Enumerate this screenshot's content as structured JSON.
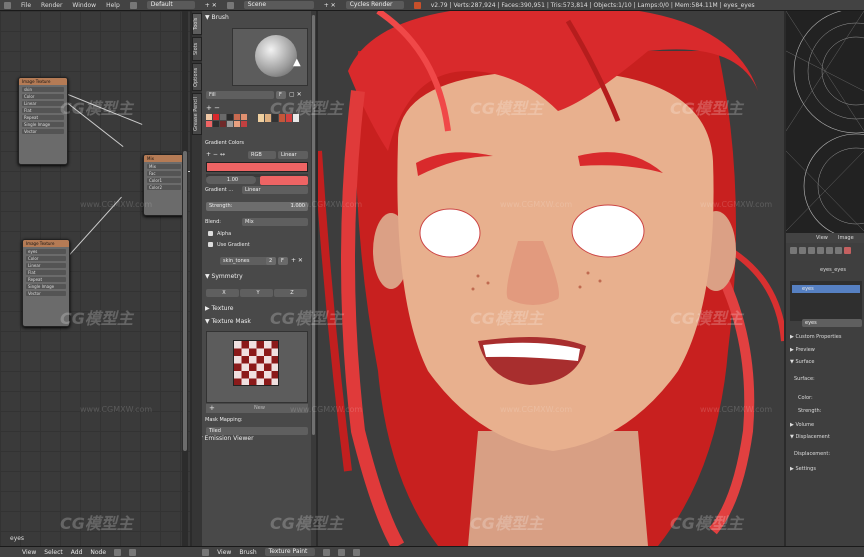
{
  "topbar": {
    "menus": [
      "File",
      "Render",
      "Window",
      "Help"
    ],
    "layout": "Default",
    "scene": "Scene",
    "engine": "Cycles Render",
    "stats": "v2.79 | Verts:287,924 | Faces:390,951 | Tris:573,814 | Objects:1/10 | Lamps:0/0 | Mem:584.11M | eyes_eyes"
  },
  "node_editor": {
    "nodes": [
      {
        "title": "Image Texture",
        "rows": [
          "skin",
          "Color",
          "Linear",
          "Flat",
          "Repeat",
          "Single Image",
          "Vector"
        ]
      },
      {
        "title": "Mix",
        "rows": [
          "Mix",
          "Fac",
          "Color1",
          "Color2"
        ]
      },
      {
        "title": "Image Texture",
        "rows": [
          "eyes",
          "Color",
          "Linear",
          "Flat",
          "Repeat",
          "Single Image",
          "Vector"
        ]
      }
    ],
    "footer_label": "eyes"
  },
  "tabs": [
    "Tools",
    "Slots",
    "Options",
    "Grease Pencil"
  ],
  "toolshelf": {
    "brush_header": "Brush",
    "brush_name": "Fill",
    "brush_users": "F",
    "gradient_colors_label": "Gradient Colors",
    "color_mode": "RGB",
    "interp_mode": "Linear",
    "gradient_pos": "1.00",
    "gradient_type_label": "Gradient ...",
    "gradient_type": "Linear",
    "strength_label": "Strength:",
    "strength_value": "1.000",
    "blend_label": "Blend:",
    "blend_value": "Mix",
    "alpha_label": "Alpha",
    "use_gradient_label": "Use Gradient",
    "palette_name": "skin_tones",
    "palette_count": "2",
    "palette_f": "F",
    "symmetry_header": "Symmetry",
    "axes": [
      "X",
      "Y",
      "Z"
    ],
    "texture_header": "Texture",
    "texture_mask_header": "Texture Mask",
    "new_label": "New",
    "mask_mapping_label": "Mask Mapping:",
    "mask_mapping_value": "Tiled",
    "emission_viewer": "Emission Viewer"
  },
  "right_panel": {
    "view_label": "View",
    "image_label": "Image",
    "material_name": "eyes_eyes",
    "slot_name": "eyes",
    "material_field": "eyes",
    "sections": [
      "Custom Properties",
      "Preview",
      "Surface"
    ],
    "surface_label": "Surface:",
    "color_label": "Color:",
    "strength_label": "Strength:",
    "volume_label": "Volume",
    "displacement_label": "Displacement",
    "displacement_field": "Displacement:",
    "settings_label": "Settings"
  },
  "bottombar": {
    "left_menus": [
      "View",
      "Select",
      "Add",
      "Node"
    ],
    "mid_menus": [
      "View",
      "Brush"
    ],
    "mode": "Texture Paint"
  },
  "colors": {
    "hair": "#d9282c",
    "skin": "#e8b08e",
    "gradient_red": "#ee6464",
    "node_header": "#b57b55",
    "selection_blue": "#5680c2"
  },
  "watermark": {
    "brand": "CG模型主",
    "url": "www.CGMXW.com"
  }
}
